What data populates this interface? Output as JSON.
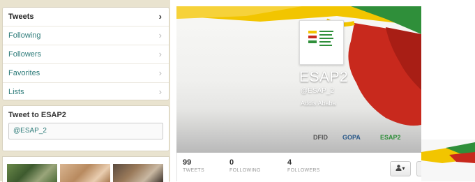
{
  "nav": {
    "items": [
      {
        "label": "Tweets",
        "active": true
      },
      {
        "label": "Following",
        "active": false
      },
      {
        "label": "Followers",
        "active": false
      },
      {
        "label": "Favorites",
        "active": false
      },
      {
        "label": "Lists",
        "active": false
      }
    ],
    "chevron": "›"
  },
  "tweet_to": {
    "title": "Tweet to ESAP2",
    "field_value": "@ESAP_2"
  },
  "profile": {
    "name": "ESAP2",
    "handle": "@ESAP_2",
    "location": "Addis Ababa",
    "partners": [
      "DFID",
      "GOPA",
      "ESAP2"
    ]
  },
  "stats": [
    {
      "number": "99",
      "label": "TWEETS"
    },
    {
      "number": "0",
      "label": "FOLLOWING"
    },
    {
      "number": "4",
      "label": "FOLLOWERS"
    }
  ],
  "follow_button": {
    "icon": "user-dropdown-icon",
    "label": "▾"
  },
  "colors": {
    "yellow": "#f2c500",
    "red": "#c8291d",
    "green": "#2f8f3a",
    "teal": "#2b7a78"
  }
}
